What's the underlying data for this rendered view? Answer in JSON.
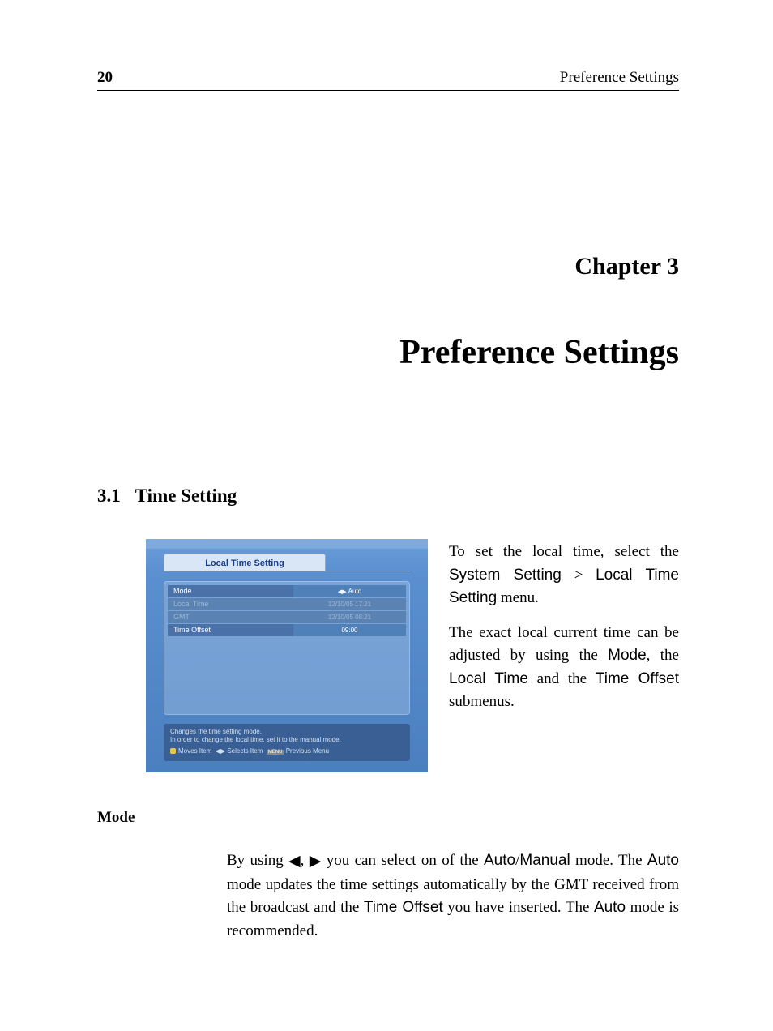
{
  "header": {
    "page_number": "20",
    "running_title": "Preference Settings"
  },
  "chapter": {
    "label": "Chapter 3",
    "title": "Preference Settings"
  },
  "section": {
    "number": "3.1",
    "title": "Time Setting"
  },
  "figure": {
    "title": "Local Time Setting",
    "rows": [
      {
        "label": "Mode",
        "value": "Auto",
        "disabled": false,
        "arrows": true
      },
      {
        "label": "Local Time",
        "value": "12/10/05 17:21",
        "disabled": true,
        "arrows": false
      },
      {
        "label": "GMT",
        "value": "12/10/05 08:21",
        "disabled": true,
        "arrows": false
      },
      {
        "label": "Time Offset",
        "value": "09:00",
        "disabled": false,
        "arrows": false
      }
    ],
    "hint1": "Changes the time setting mode.",
    "hint2": "In order to change the local time, set it to the manual mode.",
    "nav_moves": "Moves Item",
    "nav_selects": "Selects Item",
    "nav_menu_key": "MENU",
    "nav_prev": "Previous Menu"
  },
  "intro": {
    "p1a": "To set the local time, select the ",
    "p1b": "System Setting",
    "p1c": " > ",
    "p1d": "Local Time Setting",
    "p1e": " menu.",
    "p2a": "The exact local current time can be adjusted by using the ",
    "p2b": "Mode",
    "p2c": ", the ",
    "p2d": "Local Time",
    "p2e": " and the ",
    "p2f": "Time Off­set",
    "p2g": " submenus."
  },
  "mode_section": {
    "heading": "Mode",
    "p_a": "By using ",
    "p_b": ", ",
    "p_c": " you can select on of the ",
    "p_d": "Auto",
    "p_e": "/",
    "p_f": "Manual",
    "p_g": " mode. The ",
    "p_h": "Auto",
    "p_i": " mode updates the time settings automatically by the GMT received from the broadcast and the ",
    "p_j": "Time Offset",
    "p_k": " you have inserted. The ",
    "p_l": "Auto",
    "p_m": " mode is recommended."
  }
}
